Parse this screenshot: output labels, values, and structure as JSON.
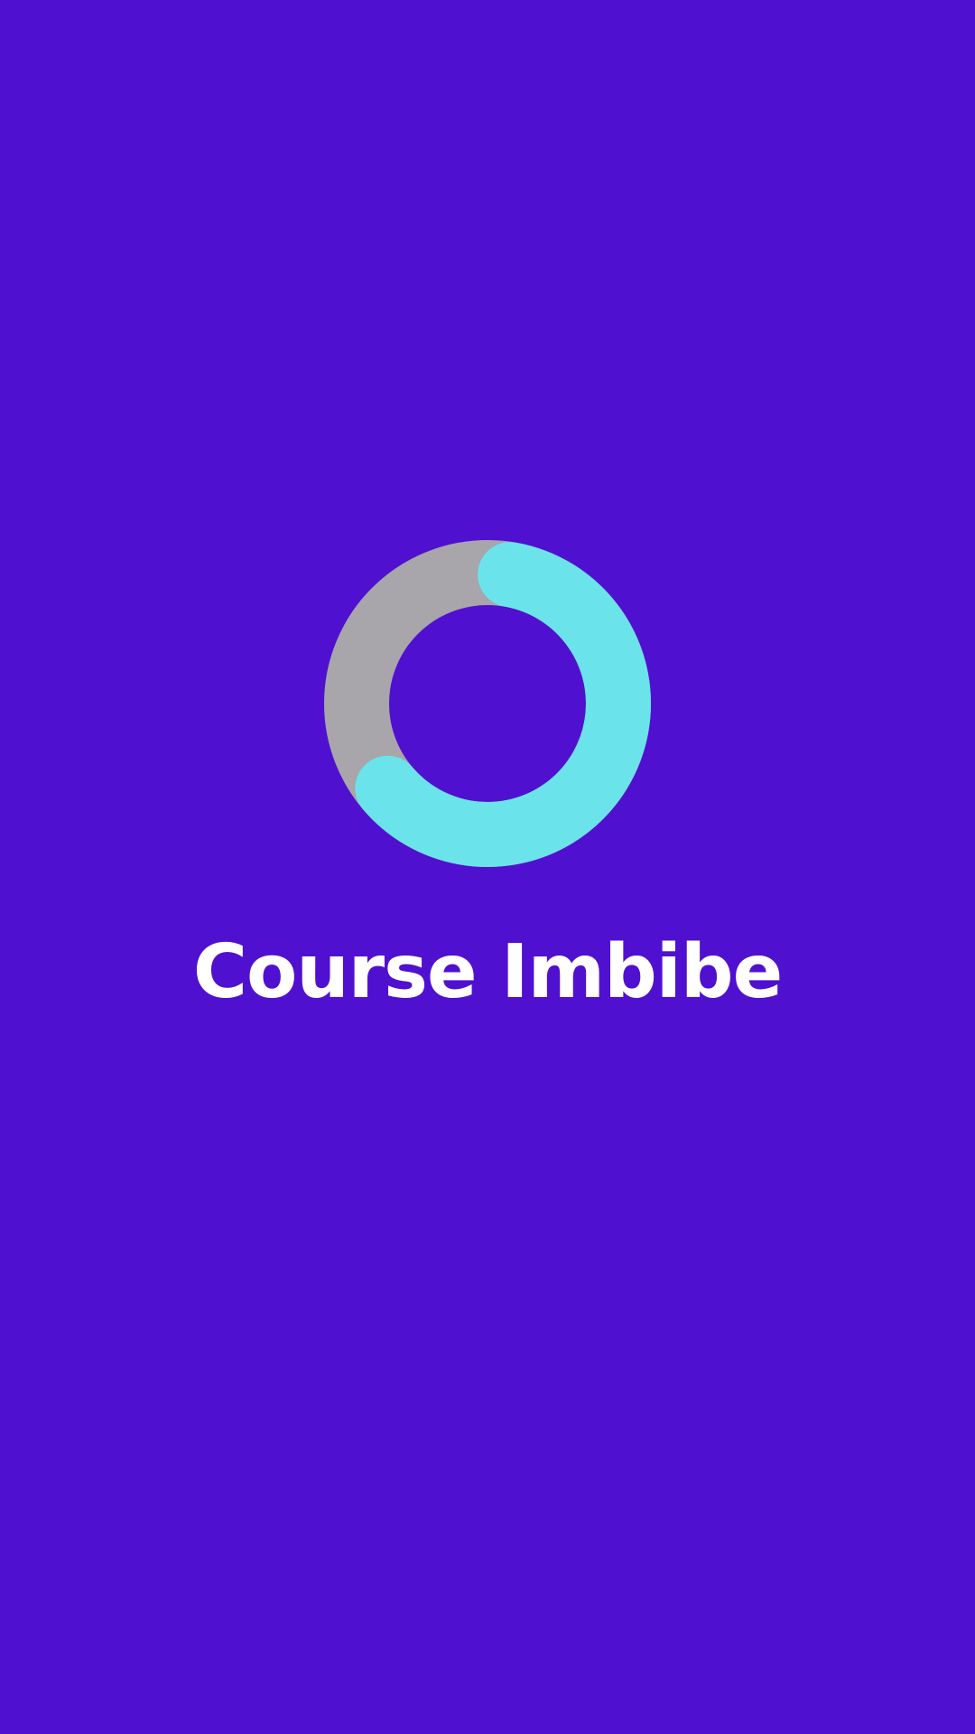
{
  "app": {
    "name": "Course Imbibe"
  },
  "colors": {
    "background": "#5010d0",
    "ring_track": "#a8a6aa",
    "ring_progress": "#6ae4ea",
    "text": "#ffffff"
  },
  "icons": {
    "logo": "progress-ring-icon"
  },
  "logo": {
    "progress_fraction": 0.61
  }
}
